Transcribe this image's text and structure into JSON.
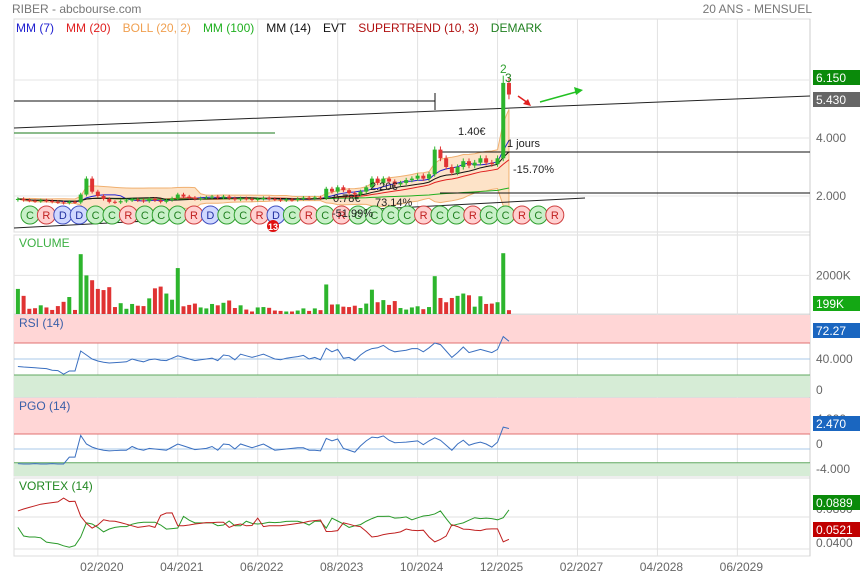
{
  "header": {
    "title": "RIBER - abcbourse.com",
    "period": "20 ANS - MENSUEL"
  },
  "legend": [
    {
      "label": "MM (7)",
      "color": "#2020d0"
    },
    {
      "label": "MM (20)",
      "color": "#e02020"
    },
    {
      "label": "BOLL (20, 2)",
      "color": "#f0a050"
    },
    {
      "label": "MM (100)",
      "color": "#20b020"
    },
    {
      "label": "MM (14)",
      "color": "#111111"
    },
    {
      "label": "EVT",
      "color": "#111111"
    },
    {
      "label": "SUPERTREND (10, 3)",
      "color": "#b01010"
    },
    {
      "label": "DEMARK",
      "color": "#208020"
    }
  ],
  "colors": {
    "up": "#2db52d",
    "down": "#e03333",
    "boll_fill": "#fde3c8",
    "boll_line": "#f0b070",
    "rsi_line": "#3a6fc0",
    "overbought_zone": "#ffd6d6",
    "oversold_zone": "#d6ecd6",
    "vortex_plus": "#2a9a2a",
    "vortex_minus": "#c02020"
  },
  "chart_data": [
    {
      "type": "candlestick",
      "name": "price",
      "first_month": "12/2018",
      "frequency": "monthly",
      "x_ticks": [
        "02/2020",
        "04/2021",
        "06/2022",
        "08/2023",
        "10/2024",
        "12/2025",
        "02/2027",
        "04/2028",
        "06/2029"
      ],
      "y_ticks": [
        "2.000",
        "4.000"
      ],
      "ylim": [
        0.8,
        8.0
      ],
      "close": [
        1.9,
        1.86,
        1.84,
        1.82,
        1.85,
        1.83,
        1.8,
        1.78,
        1.76,
        1.8,
        1.78,
        2.05,
        2.6,
        2.15,
        2.0,
        1.9,
        1.8,
        1.78,
        1.82,
        1.85,
        1.88,
        1.85,
        1.82,
        1.9,
        1.85,
        1.8,
        1.86,
        1.92,
        2.05,
        1.98,
        1.94,
        1.9,
        1.92,
        1.95,
        1.98,
        1.94,
        1.98,
        1.92,
        1.88,
        1.92,
        1.9,
        1.87,
        1.9,
        1.93,
        1.9,
        1.88,
        1.85,
        1.88,
        1.86,
        1.9,
        1.94,
        1.91,
        1.95,
        1.92,
        2.25,
        2.15,
        2.3,
        2.2,
        2.1,
        2.05,
        2.15,
        2.3,
        2.6,
        2.45,
        2.6,
        2.5,
        2.4,
        2.45,
        2.55,
        2.6,
        2.7,
        2.6,
        2.75,
        3.6,
        3.3,
        3.0,
        2.8,
        3.0,
        3.2,
        3.05,
        3.15,
        3.3,
        3.15,
        3.1,
        3.3,
        5.9,
        5.5
      ],
      "last_high_label": "6.150",
      "trendline_label": "5.430",
      "annotations": [
        "1.40€",
        "1 jours",
        "-15.70%",
        "0.78€",
        "-51.99%",
        "2.20€",
        "73.14%"
      ],
      "demark_counts": [
        "2",
        "3"
      ],
      "event_badge": "13",
      "demark_signals": [
        "C",
        "R",
        "D",
        "D",
        "C",
        "C",
        "R",
        "C",
        "C",
        "C",
        "R",
        "D",
        "C",
        "C",
        "R",
        "D",
        "C",
        "R",
        "C",
        "R",
        "C",
        "C",
        "C",
        "C",
        "R",
        "C",
        "C",
        "R",
        "C",
        "C",
        "R",
        "C",
        "R"
      ]
    },
    {
      "type": "bar",
      "name": "VOLUME",
      "title": "VOLUME",
      "y_ticks": [
        "2000K"
      ],
      "last_label": "199K",
      "values_k": [
        1300,
        940,
        270,
        300,
        450,
        340,
        210,
        410,
        630,
        880,
        210,
        3100,
        2000,
        1750,
        1300,
        1240,
        1390,
        360,
        560,
        270,
        520,
        430,
        410,
        810,
        1330,
        1420,
        1060,
        740,
        2380,
        400,
        470,
        540,
        340,
        290,
        520,
        450,
        580,
        700,
        310,
        450,
        230,
        130,
        340,
        360,
        320,
        180,
        160,
        130,
        130,
        180,
        290,
        160,
        290,
        200,
        1530,
        490,
        500,
        380,
        360,
        430,
        310,
        540,
        1260,
        610,
        720,
        470,
        670,
        310,
        230,
        340,
        400,
        250,
        360,
        1960,
        830,
        610,
        830,
        940,
        1060,
        970,
        380,
        920,
        520,
        540,
        610,
        3150,
        199
      ]
    },
    {
      "type": "line",
      "name": "RSI",
      "title": "RSI (14)",
      "y_ticks": [
        "40.000",
        "0"
      ],
      "last_label": "72.27",
      "overbought": 70,
      "mid": 50,
      "oversold": 30,
      "values": [
        40.7,
        40,
        39.5,
        39,
        38.5,
        38,
        36,
        35.5,
        31,
        35,
        35,
        60,
        55,
        50,
        47.5,
        46,
        45,
        45.5,
        46,
        46.5,
        50,
        48,
        46.5,
        49,
        50,
        48.5,
        48,
        51,
        54,
        52,
        50,
        48,
        49,
        50,
        51,
        48,
        55,
        54,
        49,
        56,
        54,
        52,
        54,
        56,
        53,
        50,
        49,
        51,
        52,
        53,
        54.5,
        50,
        52,
        49,
        63.5,
        59,
        62,
        51,
        52,
        48,
        55,
        60,
        63,
        64,
        67,
        62,
        59,
        60,
        61,
        63,
        63,
        59,
        64,
        70,
        68,
        60,
        52,
        58,
        65,
        58,
        60,
        62,
        60,
        58,
        62,
        78,
        72.27
      ]
    },
    {
      "type": "line",
      "name": "PGO",
      "title": "PGO (14)",
      "y_ticks": [
        "4.000",
        "0",
        "-4.000"
      ],
      "last_label": "2.470",
      "upper": 1.6,
      "mid": -0.8,
      "lower": -3.0,
      "values": [
        -3.15,
        -3.2,
        -3.2,
        -3.15,
        -3.2,
        -3.2,
        -3.15,
        -3.2,
        -3.2,
        -2.1,
        -2.1,
        1.36,
        0,
        -0.5,
        -0.8,
        -1.0,
        -1.1,
        -1.05,
        -1.0,
        -1.0,
        -0.4,
        -0.8,
        -1.0,
        -0.7,
        -0.8,
        -0.9,
        -1.0,
        -0.5,
        0,
        -0.3,
        -0.6,
        -0.9,
        -0.8,
        -0.7,
        -0.4,
        -1.0,
        0,
        -0.1,
        -0.8,
        0,
        -0.3,
        -0.6,
        -0.3,
        0,
        -0.5,
        -1.0,
        -0.9,
        -0.8,
        -0.7,
        -0.6,
        -0.6,
        -1.0,
        -1.0,
        -1.1,
        0.9,
        0.5,
        0.8,
        -0.7,
        -1.0,
        -1.3,
        -0.3,
        0.5,
        1.1,
        1.0,
        1.3,
        0.6,
        0.2,
        0.25,
        0.3,
        0.4,
        0.5,
        -0.1,
        0.5,
        1.0,
        0.6,
        -0.2,
        -1.0,
        0,
        0.6,
        -0.2,
        0.1,
        0.3,
        0,
        -0.5,
        0.3,
        2.7,
        2.47
      ]
    },
    {
      "type": "line",
      "name": "VORTEX",
      "title": "VORTEX (14)",
      "y_ticks": [
        "0.0800",
        "0.0400"
      ],
      "series": [
        {
          "key": "plus",
          "last_label": "0.0889",
          "values": [
            0.067,
            0.0562,
            0.055,
            0.055,
            0.054,
            0.0486,
            0.0475,
            0.0465,
            0.044,
            0.0422,
            0.0443,
            0.055,
            0.0727,
            0.0713,
            0.067,
            0.0614,
            0.065,
            0.067,
            0.0679,
            0.0679,
            0.071,
            0.0727,
            0.0735,
            0.0735,
            0.0735,
            0.07,
            0.0649,
            0.0655,
            0.0662,
            0.0808,
            0.076,
            0.0727,
            0.0727,
            0.0727,
            0.0727,
            0.0691,
            0.07,
            0.075,
            0.0691,
            0.069,
            0.0747,
            0.072,
            0.0713,
            0.072,
            0.0735,
            0.073,
            0.0735,
            0.0745,
            0.0747,
            0.0747,
            0.073,
            0.07,
            0.0747,
            0.0747,
            0.0661,
            0.0786,
            0.075,
            0.0713,
            0.067,
            0.069,
            0.0705,
            0.0747,
            0.078,
            0.0808,
            0.0808,
            0.081,
            0.0786,
            0.079,
            0.0801,
            0.0765,
            0.079,
            0.0812,
            0.082,
            0.0838,
            0.0876,
            0.078,
            0.0691,
            0.071,
            0.0727,
            0.076,
            0.0791,
            0.078,
            0.0786,
            0.078,
            0.0765,
            0.0791,
            0.0889
          ]
        },
        {
          "key": "minus",
          "last_label": "0.0521",
          "values": [
            0.0876,
            0.09,
            0.092,
            0.094,
            0.096,
            0.097,
            0.098,
            0.0989,
            0.1036,
            0.0993,
            0.0997,
            0.081,
            0.072,
            0.0661,
            0.07,
            0.0765,
            0.075,
            0.0747,
            0.073,
            0.071,
            0.069,
            0.067,
            0.068,
            0.069,
            0.067,
            0.082,
            0.085,
            0.0851,
            0.0691,
            0.069,
            0.07,
            0.0713,
            0.072,
            0.073,
            0.073,
            0.0735,
            0.0735,
            0.067,
            0.07,
            0.0713,
            0.069,
            0.0694,
            0.0786,
            0.068,
            0.069,
            0.069,
            0.0691,
            0.07,
            0.071,
            0.072,
            0.073,
            0.0747,
            0.0755,
            0.0762,
            0.0619,
            0.062,
            0.063,
            0.0727,
            0.071,
            0.069,
            0.0679,
            0.062,
            0.055,
            0.056,
            0.058,
            0.0592,
            0.06,
            0.0614,
            0.065,
            0.0635,
            0.063,
            0.0635,
            0.055,
            0.0489,
            0.052,
            0.0562,
            0.0704,
            0.068,
            0.0649,
            0.0645,
            0.0635,
            0.063,
            0.0649,
            0.0652,
            0.0652,
            0.0489,
            0.0521
          ]
        }
      ]
    }
  ]
}
